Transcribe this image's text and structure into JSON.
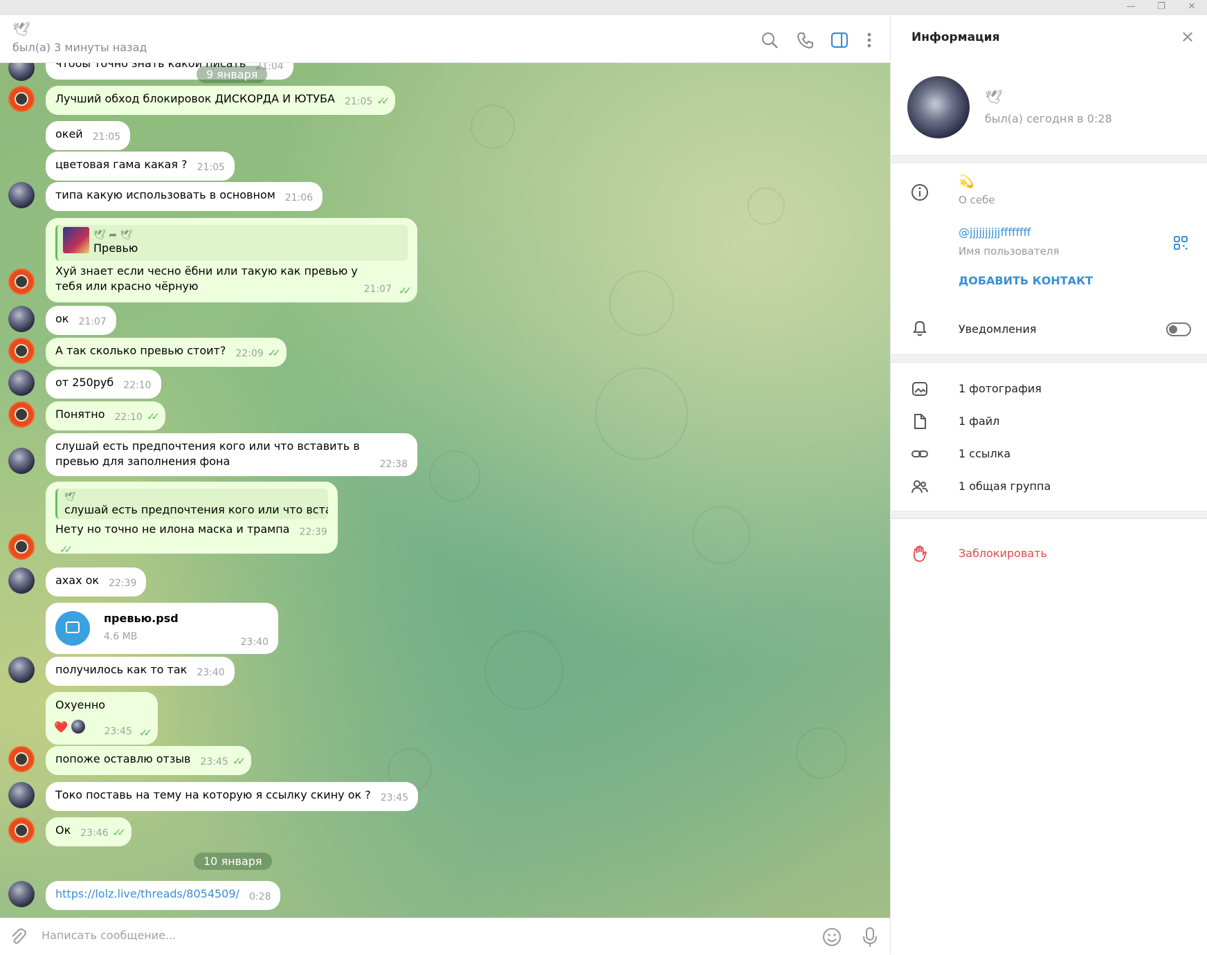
{
  "window": {
    "minimize": "—",
    "restore": "❐",
    "close": "✕"
  },
  "header": {
    "peer_name": "🕊",
    "status": "был(а) 3 минуты назад"
  },
  "dates": {
    "jan9": "9 января",
    "jan10": "10 января"
  },
  "messages": [
    {
      "dir": "in",
      "text": "чтобы точно знать какой писать",
      "time": "21:04"
    },
    {
      "dir": "out",
      "text": "Лучший обход блокировок ДИСКОРДА И ЮТУБА",
      "time": "21:05"
    },
    {
      "dir": "in",
      "text": "окей",
      "time": "21:05"
    },
    {
      "dir": "in",
      "text": "цветовая гама какая ?",
      "time": "21:05"
    },
    {
      "dir": "in",
      "text": "типа какую использовать в основном",
      "time": "21:06"
    },
    {
      "dir": "out",
      "reply_from": "🕊 ➦ 🕊",
      "reply_text": "Превью",
      "text": "Хуй знает если чесно ёбни или такую как превью у тебя или красно чёрную",
      "time": "21:07"
    },
    {
      "dir": "in",
      "text": "ок",
      "time": "21:07"
    },
    {
      "dir": "out",
      "text": "А так сколько превью стоит?",
      "time": "22:09"
    },
    {
      "dir": "in",
      "text": "от 250руб",
      "time": "22:10"
    },
    {
      "dir": "out",
      "text": "Понятно",
      "time": "22:10"
    },
    {
      "dir": "in",
      "text": "слушай есть предпочтения кого или что вставить в превью для заполнения  фона",
      "time": "22:38"
    },
    {
      "dir": "out",
      "reply_from": "🕊",
      "reply_text": "слушай есть предпочтения кого или что встав...",
      "text": "Нету но точно не илона маска и трампа",
      "time": "22:39"
    },
    {
      "dir": "in",
      "text": "ахах ок",
      "time": "22:39"
    },
    {
      "dir": "in",
      "file_name": "превью.psd",
      "file_size": "4.6 MB",
      "time": "23:40"
    },
    {
      "dir": "in",
      "text": "получилось как то так",
      "time": "23:40"
    },
    {
      "dir": "out",
      "text": "Охуенно",
      "reaction": "❤️",
      "time": "23:45"
    },
    {
      "dir": "out",
      "text": "попоже оставлю отзыв",
      "time": "23:45"
    },
    {
      "dir": "in",
      "text": "Токо поставь на тему на которую я ссылку скину ок ?",
      "time": "23:45"
    },
    {
      "dir": "out",
      "text": "Ок",
      "time": "23:46"
    },
    {
      "dir": "in",
      "link": "https://lolz.live/threads/8054509/",
      "time": "0:28"
    }
  ],
  "composer": {
    "placeholder": "Написать сообщение..."
  },
  "panel": {
    "title": "Информация",
    "close": "✕",
    "name": "🕊",
    "status": "был(а) сегодня в 0:28",
    "bio_value": "💫",
    "bio_label": "О себе",
    "username": "@jjjjjjjjjjffffffff",
    "username_label": "Имя пользователя",
    "add_contact": "ДОБАВИТЬ КОНТАКТ",
    "notifications": "Уведомления",
    "notifications_on": false,
    "media": [
      {
        "label": "1 фотография",
        "icon": "photo-icon"
      },
      {
        "label": "1 файл",
        "icon": "file-icon"
      },
      {
        "label": "1 ссылка",
        "icon": "link-icon"
      },
      {
        "label": "1 общая группа",
        "icon": "group-icon"
      }
    ],
    "block": "Заблокировать"
  },
  "colors": {
    "outgoing": "#eeffde",
    "incoming": "#ffffff",
    "accent": "#3a8fd6",
    "danger": "#e0474c",
    "check": "#5fbf5f"
  }
}
